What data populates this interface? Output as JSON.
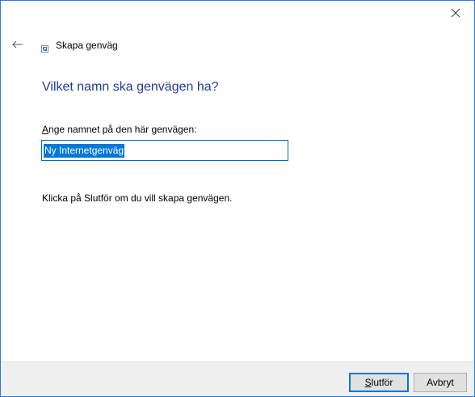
{
  "window": {
    "title": "Skapa genväg"
  },
  "titlebar": {
    "close_icon": "close-icon"
  },
  "header": {
    "back_icon": "back-arrow-icon",
    "wizard_icon": "shortcut-wizard-icon",
    "title": "Skapa genväg"
  },
  "main": {
    "heading": "Vilket namn ska genvägen ha?",
    "field_label_accesskey": "A",
    "field_label_rest": "nge namnet på den här genvägen:",
    "name_value": "Ny Internetgenväg",
    "instruction": "Klicka på Slutför om du vill skapa genvägen."
  },
  "footer": {
    "finish_accesskey": "S",
    "finish_rest": "lutför",
    "cancel_label": "Avbryt"
  },
  "colors": {
    "accent": "#0078d7",
    "heading": "#1f3d99",
    "window_border": "#2b79d8"
  }
}
